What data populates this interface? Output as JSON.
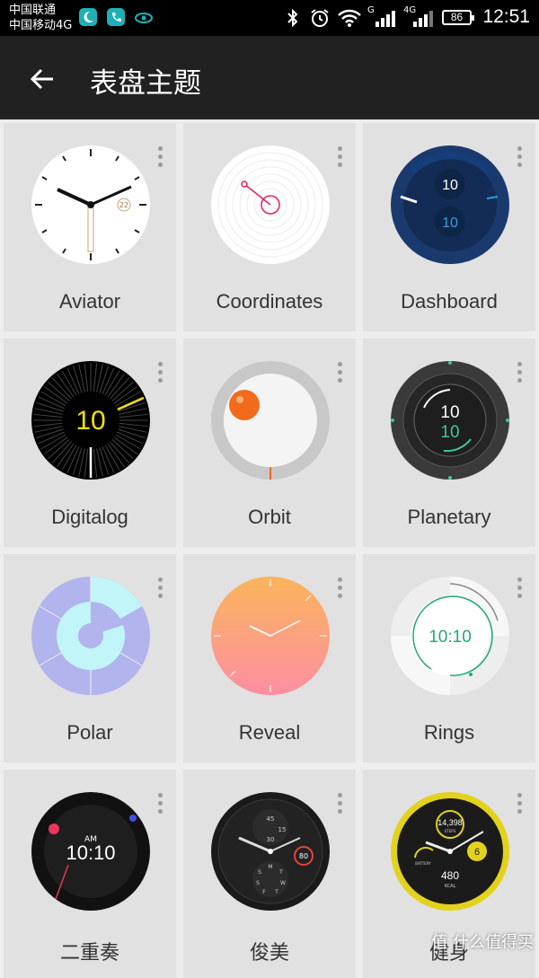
{
  "status_bar": {
    "carrier1": "中国联通",
    "carrier2": "中国移动4G",
    "signal1_label": "G",
    "signal2_label": "4G",
    "battery": "86",
    "time": "12:51"
  },
  "app_bar": {
    "title": "表盘主题"
  },
  "watch_faces": [
    {
      "label": "Aviator",
      "complication": "22"
    },
    {
      "label": "Coordinates"
    },
    {
      "label": "Dashboard",
      "value1": "10",
      "value2": "10"
    },
    {
      "label": "Digitalog",
      "value": "10"
    },
    {
      "label": "Orbit"
    },
    {
      "label": "Planetary",
      "value1": "10",
      "value2": "10"
    },
    {
      "label": "Polar"
    },
    {
      "label": "Reveal"
    },
    {
      "label": "Rings",
      "time": "10:10"
    },
    {
      "label": "二重奏",
      "ampm": "AM",
      "time": "10:10"
    },
    {
      "label": "俊美",
      "badge": "80",
      "sub_dial_top": [
        "45",
        "15",
        "30"
      ],
      "sub_dial_bottom": [
        "M",
        "T",
        "W",
        "T",
        "F",
        "S",
        "S"
      ]
    },
    {
      "label": "健身",
      "steps": "14,398",
      "steps_label": "STEPS",
      "badge": "6",
      "battery_label": "BATTERY",
      "kcal": "480",
      "kcal_label": "KCAL"
    }
  ],
  "watermark": "值 什么值得买"
}
